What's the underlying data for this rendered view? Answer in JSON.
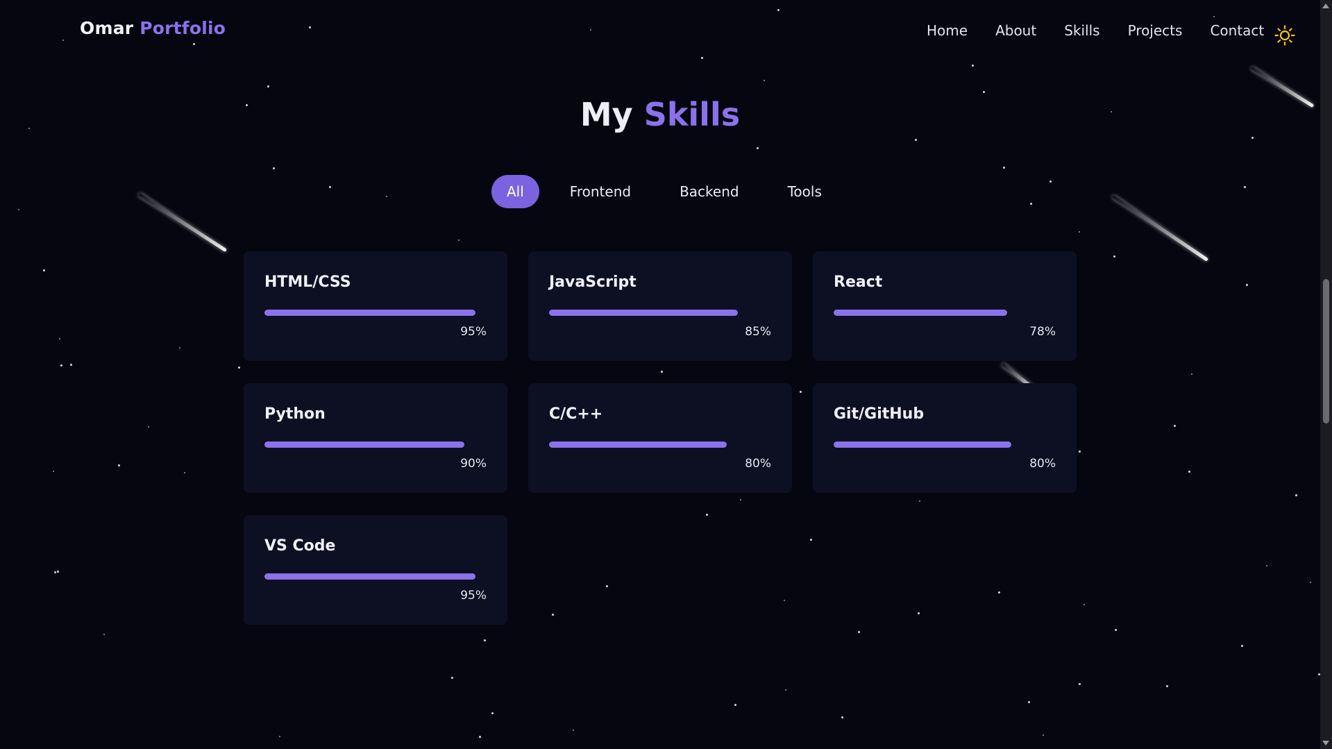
{
  "brand": {
    "first": "Omar",
    "second": "Portfolio",
    "accent_color": "#8b72ea"
  },
  "nav": {
    "items": [
      {
        "label": "Home"
      },
      {
        "label": "About"
      },
      {
        "label": "Skills"
      },
      {
        "label": "Projects"
      },
      {
        "label": "Contact"
      }
    ],
    "theme_toggle_icon": "sun-icon"
  },
  "section": {
    "title_first": "My",
    "title_second": "Skills"
  },
  "filters": {
    "items": [
      {
        "label": "All",
        "active": true
      },
      {
        "label": "Frontend",
        "active": false
      },
      {
        "label": "Backend",
        "active": false
      },
      {
        "label": "Tools",
        "active": false
      }
    ]
  },
  "skills": [
    {
      "name": "HTML/CSS",
      "percent_label": "95%",
      "level": 0.95
    },
    {
      "name": "JavaScript",
      "percent_label": "85%",
      "level": 0.85
    },
    {
      "name": "React",
      "percent_label": "78%",
      "level": 0.78
    },
    {
      "name": "Python",
      "percent_label": "90%",
      "level": 0.9
    },
    {
      "name": "C/C++",
      "percent_label": "80%",
      "level": 0.8
    },
    {
      "name": "Git/GitHub",
      "percent_label": "80%",
      "level": 0.8
    },
    {
      "name": "VS Code",
      "percent_label": "95%",
      "level": 0.95
    }
  ],
  "colors": {
    "background": "#05060f",
    "card": "#0c1022",
    "accent": "#8b72ea",
    "active_filter": "#7b63e0"
  }
}
